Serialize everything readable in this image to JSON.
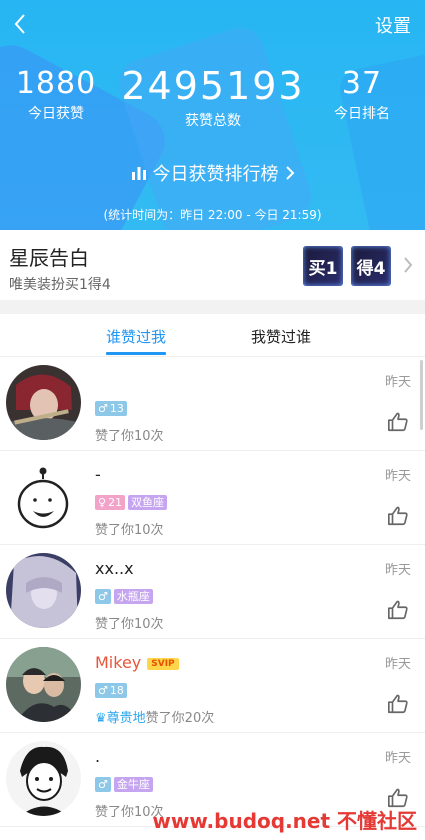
{
  "header": {
    "settings_label": "设置",
    "stats": [
      {
        "value": "1880",
        "label": "今日获赞"
      },
      {
        "value": "2495193",
        "label": "获赞总数"
      },
      {
        "value": "37",
        "label": "今日排名"
      }
    ],
    "ranking_link": "今日获赞排行榜",
    "period": "(统计时间为：昨日 22:00 - 今日 21:59)"
  },
  "promo": {
    "title": "星辰告白",
    "subtitle": "唯美装扮买1得4",
    "badges": [
      "买1",
      "得4"
    ]
  },
  "tabs": [
    {
      "label": "谁赞过我",
      "active": true
    },
    {
      "label": "我赞过谁",
      "active": false
    }
  ],
  "list": [
    {
      "name": "",
      "tags": [
        {
          "text": "13",
          "color": "#8ec8e8",
          "icon": "male-icon"
        }
      ],
      "like_text": "赞了你10次",
      "time": "昨天"
    },
    {
      "name": "-",
      "tags": [
        {
          "text": "21",
          "color": "#f3a3c8",
          "icon": "female-icon"
        },
        {
          "text": "双鱼座",
          "color": "#c6a5f0",
          "icon": ""
        }
      ],
      "like_text": "赞了你10次",
      "time": "昨天"
    },
    {
      "name": "xx..x",
      "tags": [
        {
          "text": "",
          "color": "#8ec8e8",
          "icon": "male-icon"
        },
        {
          "text": "水瓶座",
          "color": "#c6a5f0",
          "icon": ""
        }
      ],
      "like_text": "赞了你10次",
      "time": "昨天"
    },
    {
      "name": "Mikey",
      "name_color": "#e8553a",
      "badge": "SVIP",
      "tags": [
        {
          "text": "18",
          "color": "#8ec8e8",
          "icon": "male-icon"
        }
      ],
      "vip_label": "尊贵地",
      "like_text": "赞了你20次",
      "time": "昨天"
    },
    {
      "name": ".",
      "tags": [
        {
          "text": "",
          "color": "#8ec8e8",
          "icon": "male-icon"
        },
        {
          "text": "金牛座",
          "color": "#c6a5f0",
          "icon": ""
        }
      ],
      "like_text": "赞了你10次",
      "time": "昨天"
    }
  ],
  "watermark": {
    "url": "www.budoq.net",
    "cn": "不懂社区"
  }
}
